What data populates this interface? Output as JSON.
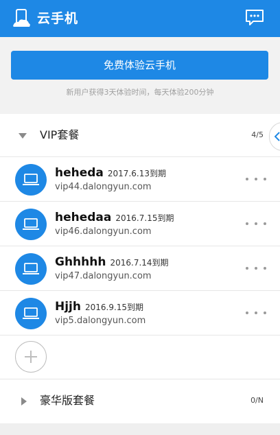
{
  "app": {
    "title": "云手机"
  },
  "trial": {
    "button_label": "免费体验云手机",
    "note": "新用户获得3天体验时间，每天体验200分钟"
  },
  "groups": {
    "vip": {
      "label": "VIP套餐",
      "count": "4/5"
    },
    "luxury": {
      "label": "豪华版套餐",
      "count": "0/N"
    }
  },
  "devices": [
    {
      "name": "heheda",
      "expiry": "2017.6.13到期",
      "host": "vip44.dalongyun.com"
    },
    {
      "name": "hehedaa",
      "expiry": "2016.7.15到期",
      "host": "vip46.dalongyun.com"
    },
    {
      "name": "Ghhhhh",
      "expiry": "2016.7.14到期",
      "host": "vip47.dalongyun.com"
    },
    {
      "name": "Hjjh",
      "expiry": "2016.9.15到期",
      "host": "vip5.dalongyun.com"
    }
  ],
  "icons": {
    "logo": "phone-cloud-icon",
    "message": "message-icon",
    "device": "laptop-icon",
    "more": "more-dots-icon",
    "add": "plus-icon",
    "collapse": "chevron-left-icon"
  },
  "colors": {
    "primary": "#1e88e5",
    "background": "#f2f2f2",
    "divider": "#e6e6e6"
  }
}
